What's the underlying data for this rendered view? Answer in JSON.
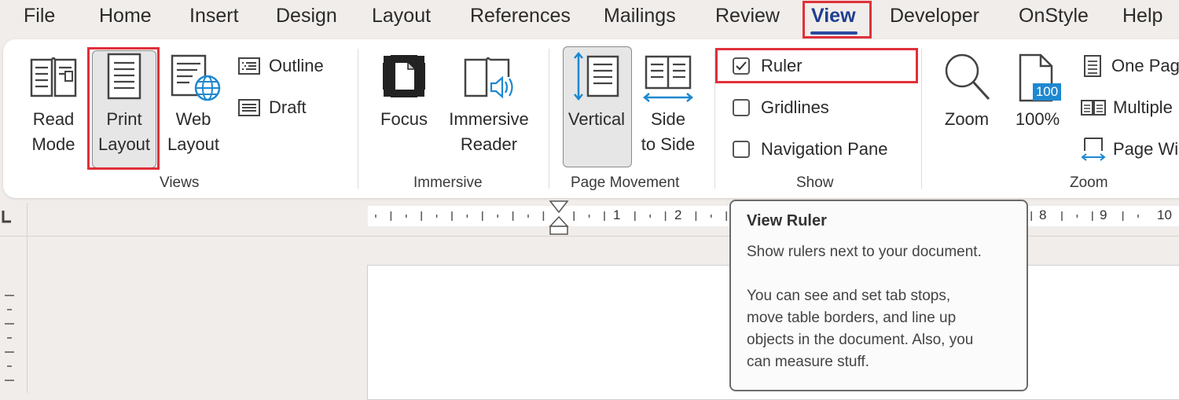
{
  "menu": {
    "file": "File",
    "home": "Home",
    "insert": "Insert",
    "design": "Design",
    "layout": "Layout",
    "references": "References",
    "mailings": "Mailings",
    "review": "Review",
    "view": "View",
    "developer": "Developer",
    "onstyle": "OnStyle",
    "help": "Help"
  },
  "views": {
    "read_mode": [
      "Read",
      "Mode"
    ],
    "print_layout": [
      "Print",
      "Layout"
    ],
    "web_layout": [
      "Web",
      "Layout"
    ],
    "outline": "Outline",
    "draft": "Draft",
    "group": "Views"
  },
  "immersive": {
    "focus": "Focus",
    "immersive_reader": [
      "Immersive",
      "Reader"
    ],
    "group": "Immersive"
  },
  "page_movement": {
    "vertical": "Vertical",
    "side_to_side": [
      "Side",
      "to Side"
    ],
    "group": "Page Movement"
  },
  "show": {
    "ruler": "Ruler",
    "ruler_checked": true,
    "gridlines": "Gridlines",
    "gridlines_checked": false,
    "navigation_pane": "Navigation Pane",
    "navigation_pane_checked": false,
    "group": "Show"
  },
  "zoom": {
    "zoom": "Zoom",
    "hundred": "100%",
    "hundred_badge": "100",
    "one_page": "One Pag",
    "multiple": "Multiple",
    "page_width": "Page Wi",
    "group": "Zoom"
  },
  "ruler": {
    "numbers": [
      "1",
      "2",
      "8",
      "9",
      "10"
    ]
  },
  "tooltip": {
    "title": "View Ruler",
    "line1": "Show rulers next to your document.",
    "body": [
      "You can see and set tab stops,",
      "move table borders, and line up",
      "objects in the document. Also, you",
      "can measure stuff."
    ]
  },
  "colors": {
    "highlight": "#e0303a",
    "accent": "#2a4aa0",
    "blue_icon": "#1e88d0"
  }
}
